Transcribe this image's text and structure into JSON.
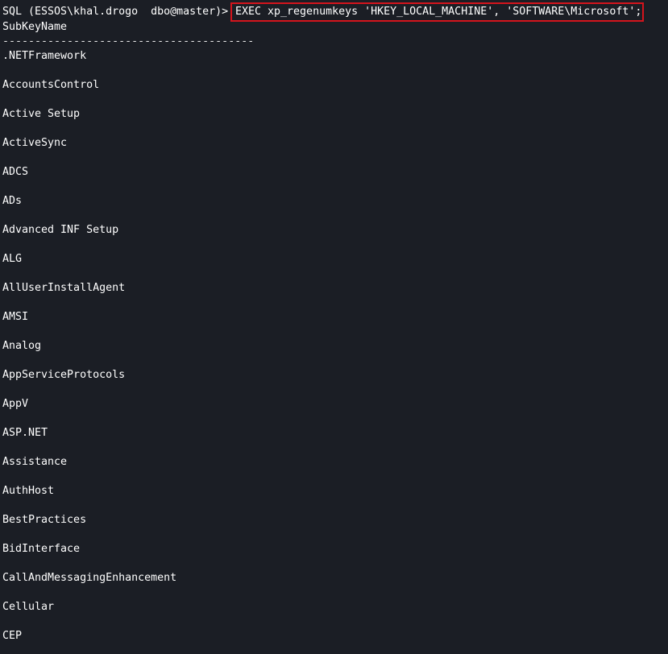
{
  "prompt": "SQL (ESSOS\\khal.drogo  dbo@master)>",
  "command": "EXEC xp_regenumkeys 'HKEY_LOCAL_MACHINE', 'SOFTWARE\\Microsoft';",
  "highlight_color": "#d4141c",
  "column_header": "SubKeyName",
  "separator": "---------------------------------------",
  "subkeys": [
    ".NETFramework",
    "AccountsControl",
    "Active Setup",
    "ActiveSync",
    "ADCS",
    "ADs",
    "Advanced INF Setup",
    "ALG",
    "AllUserInstallAgent",
    "AMSI",
    "Analog",
    "AppServiceProtocols",
    "AppV",
    "ASP.NET",
    "Assistance",
    "AuthHost",
    "BestPractices",
    "BidInterface",
    "CallAndMessagingEnhancement",
    "Cellular",
    "CEP"
  ]
}
